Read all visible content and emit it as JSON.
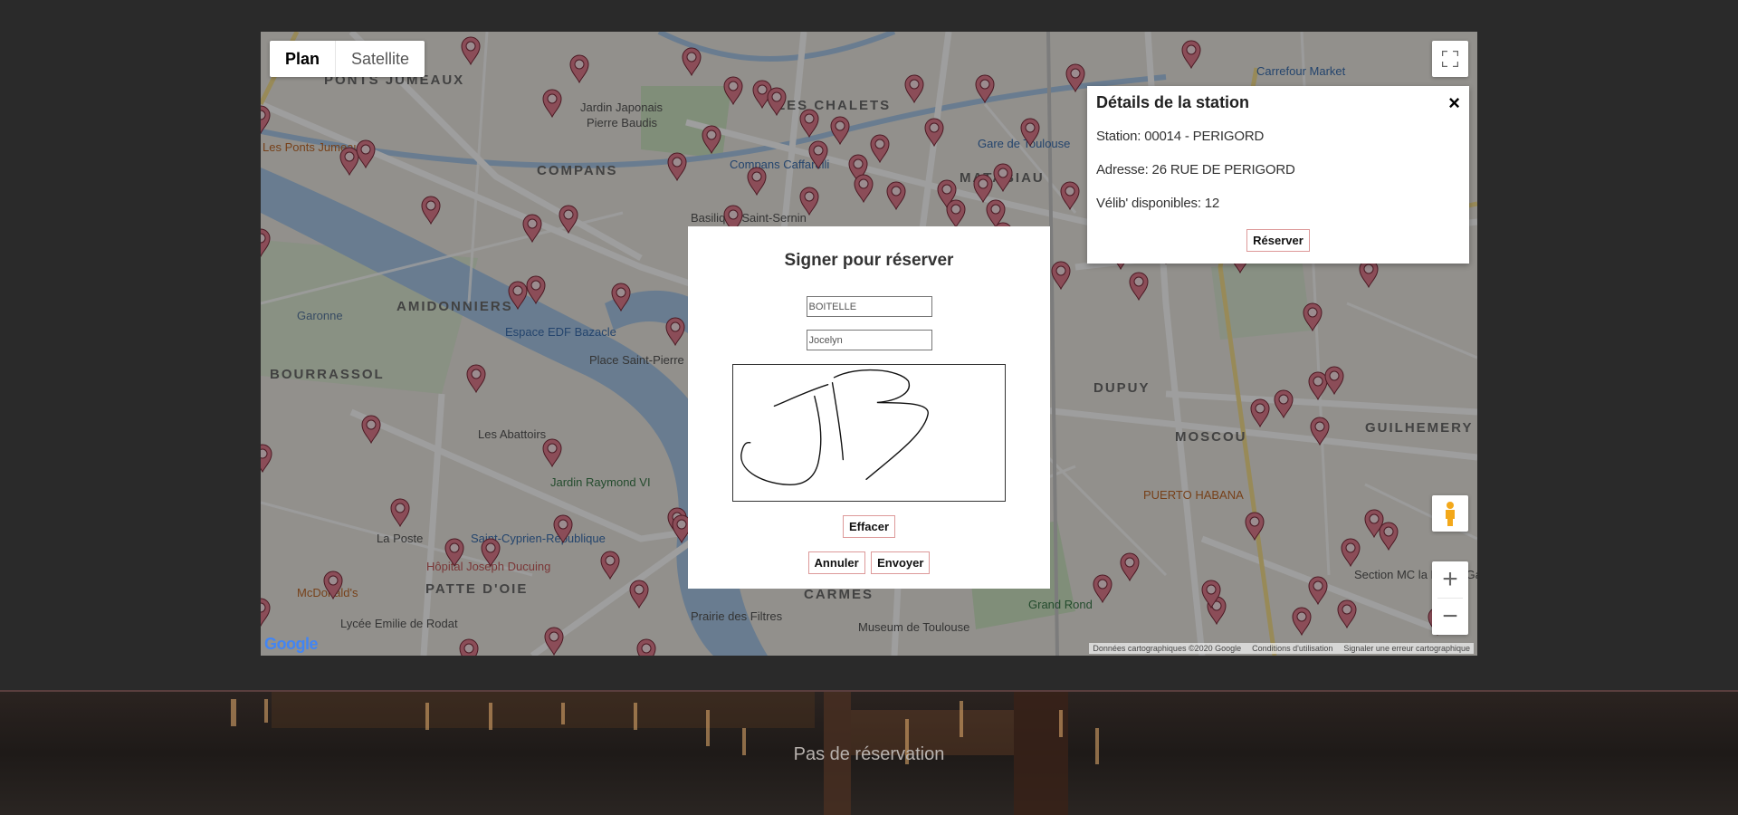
{
  "map": {
    "type_plan": "Plan",
    "type_satellite": "Satellite",
    "google": "Google",
    "attribution": [
      "Données cartographiques ©2020 Google",
      "Conditions d'utilisation",
      "Signaler une erreur cartographique"
    ],
    "labels": [
      {
        "text": "PONTS JUMEAUX"
      },
      {
        "text": "LES CHALETS"
      },
      {
        "text": "COMPANS"
      },
      {
        "text": "MATABIAU"
      },
      {
        "text": "AMIDONNIERS"
      },
      {
        "text": "BOURRASSOL"
      },
      {
        "text": "DUPUY"
      },
      {
        "text": "MOSCOU"
      },
      {
        "text": "GUILHEMERY"
      },
      {
        "text": "PATTE D'OIE"
      },
      {
        "text": "CARMES"
      },
      {
        "text": "Jardin Japonais"
      },
      {
        "text": "Pierre Baudis"
      },
      {
        "text": "Compans Caffarelli"
      },
      {
        "text": "Espace EDF Bazacle"
      },
      {
        "text": "Place Saint-Pierre"
      },
      {
        "text": "Les Abattoirs"
      },
      {
        "text": "Hôpital Joseph Ducuing"
      },
      {
        "text": "Saint-Cyprien-République"
      },
      {
        "text": "La Poste"
      },
      {
        "text": "Lycée Emilie de Rodat"
      },
      {
        "text": "McDonald's"
      },
      {
        "text": "Carrefour Market"
      },
      {
        "text": "Gare de Toulouse"
      },
      {
        "text": "PUERTO HABANA"
      },
      {
        "text": "Grand Rond"
      },
      {
        "text": "Museum de Toulouse"
      },
      {
        "text": "Prairie des Filtres"
      },
      {
        "text": "Garonne"
      },
      {
        "text": "Section MC la Haute-Ga"
      },
      {
        "text": "Jardin Raymond VI"
      },
      {
        "text": "Basilique Saint-Sernin"
      },
      {
        "text": "Les Ponts Jumeaux"
      }
    ]
  },
  "station": {
    "title": "Détails de la station",
    "close": "×",
    "station_line": "Station: 00014 - PERIGORD",
    "address_line": "Adresse: 26 RUE DE PERIGORD",
    "bikes_line": "Vélib' disponibles: 12",
    "reserve_label": "Réserver"
  },
  "modal": {
    "title": "Signer pour réserver",
    "lastname_value": "BOITELLE",
    "firstname_value": "Jocelyn",
    "clear_label": "Effacer",
    "cancel_label": "Annuler",
    "send_label": "Envoyer"
  },
  "footer": {
    "status": "Pas de réservation"
  },
  "colors": {
    "water": "#aac9e8",
    "park": "#c8e6c0",
    "marker": "#e07d8e",
    "button_border": "#dd9999"
  }
}
